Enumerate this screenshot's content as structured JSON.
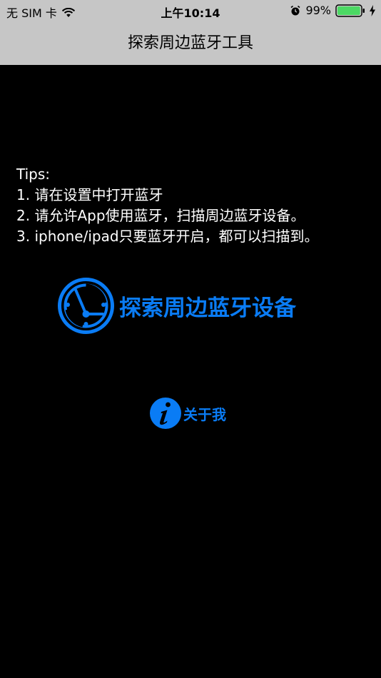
{
  "status_bar": {
    "carrier": "无 SIM 卡",
    "time": "上午10:14",
    "battery_percent": "99%",
    "battery_level": 0.99,
    "icons": [
      "wifi-icon",
      "alarm-icon",
      "battery-icon",
      "charging-icon"
    ]
  },
  "nav": {
    "title": "探索周边蓝牙工具"
  },
  "tips": {
    "heading": "Tips:",
    "lines": [
      "1. 请在设置中打开蓝牙",
      "2. 请允许App使用蓝牙，扫描周边蓝牙设备。",
      "3. iphone/ipad只要蓝牙开启，都可以扫描到。"
    ]
  },
  "scan_button": {
    "label": "探索周边蓝牙设备",
    "icon": "radar-icon"
  },
  "about_button": {
    "label": "关于我",
    "icon": "info-icon"
  },
  "colors": {
    "accent": "#0a7cf5",
    "nav_background": "#c6c6c6",
    "background": "#000000",
    "battery_fill": "#4cd964"
  }
}
